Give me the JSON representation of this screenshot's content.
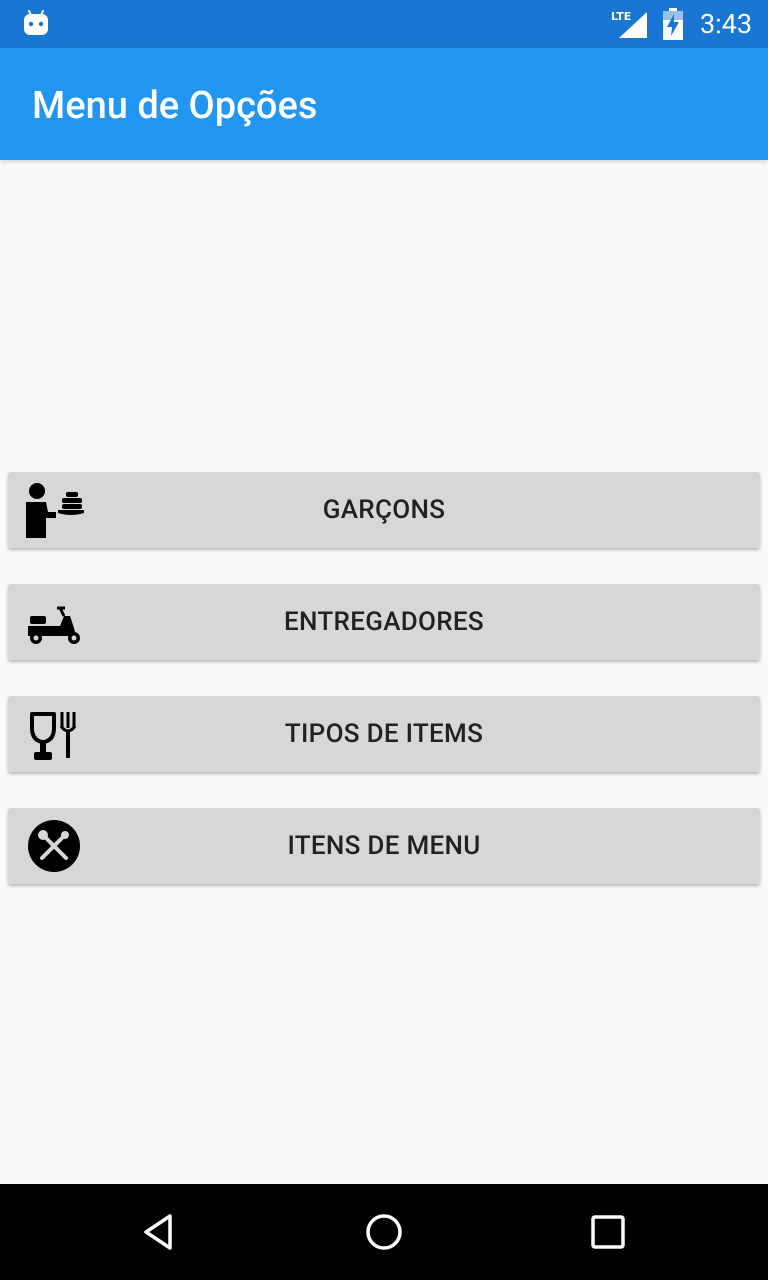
{
  "status_bar": {
    "time": "3:43",
    "network_label": "LTE",
    "icons": [
      "android-icon",
      "lte-signal-icon",
      "battery-charging-icon"
    ],
    "background": "#1976D2"
  },
  "app_bar": {
    "title": "Menu de Opções",
    "background": "#2196F3"
  },
  "menu": {
    "items": [
      {
        "label": "GARÇONS",
        "icon": "waiter-icon"
      },
      {
        "label": "ENTREGADORES",
        "icon": "scooter-icon"
      },
      {
        "label": "TIPOS DE ITEMS",
        "icon": "glass-fork-icon"
      },
      {
        "label": "ITENS DE MENU",
        "icon": "fork-knife-circle-icon"
      }
    ],
    "button_color": "#D6D7D7"
  },
  "nav_bar": {
    "buttons": [
      "back-icon",
      "home-icon",
      "recents-icon"
    ]
  }
}
